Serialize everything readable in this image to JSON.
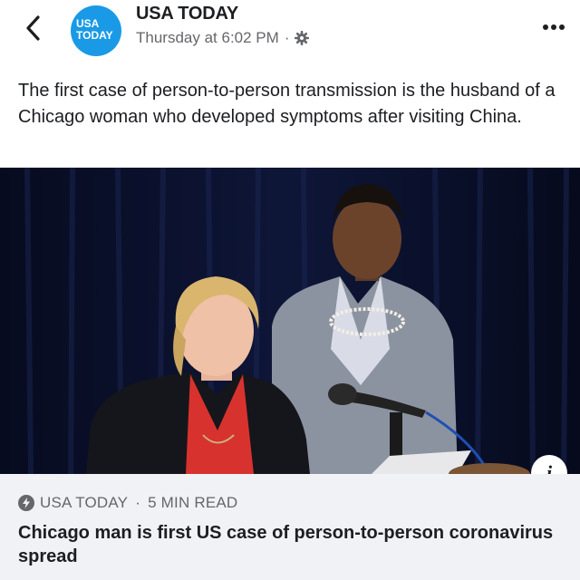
{
  "post": {
    "page_name": "USA TODAY",
    "timestamp": "Thursday at 6:02 PM",
    "separator": "·",
    "avatar_line1": "USA",
    "avatar_line2": "TODAY",
    "caption": "The first case of person-to-person transmission is the husband of a Chicago woman who developed symptoms after visiting China."
  },
  "link": {
    "source": "USA TODAY",
    "separator": "·",
    "read_time": "5 MIN READ",
    "headline": "Chicago man is first US case of person-to-person coronavirus spread",
    "info_glyph": "i"
  },
  "icons": {
    "back": "chevron-left-icon",
    "audience": "gear-icon",
    "more": "more-dots-icon",
    "instant_article": "lightning-icon",
    "info": "info-icon"
  },
  "colors": {
    "brand": "#1a9ae6",
    "text": "#1c1e21",
    "meta": "#65676b",
    "link_bg": "#f0f2f5"
  }
}
